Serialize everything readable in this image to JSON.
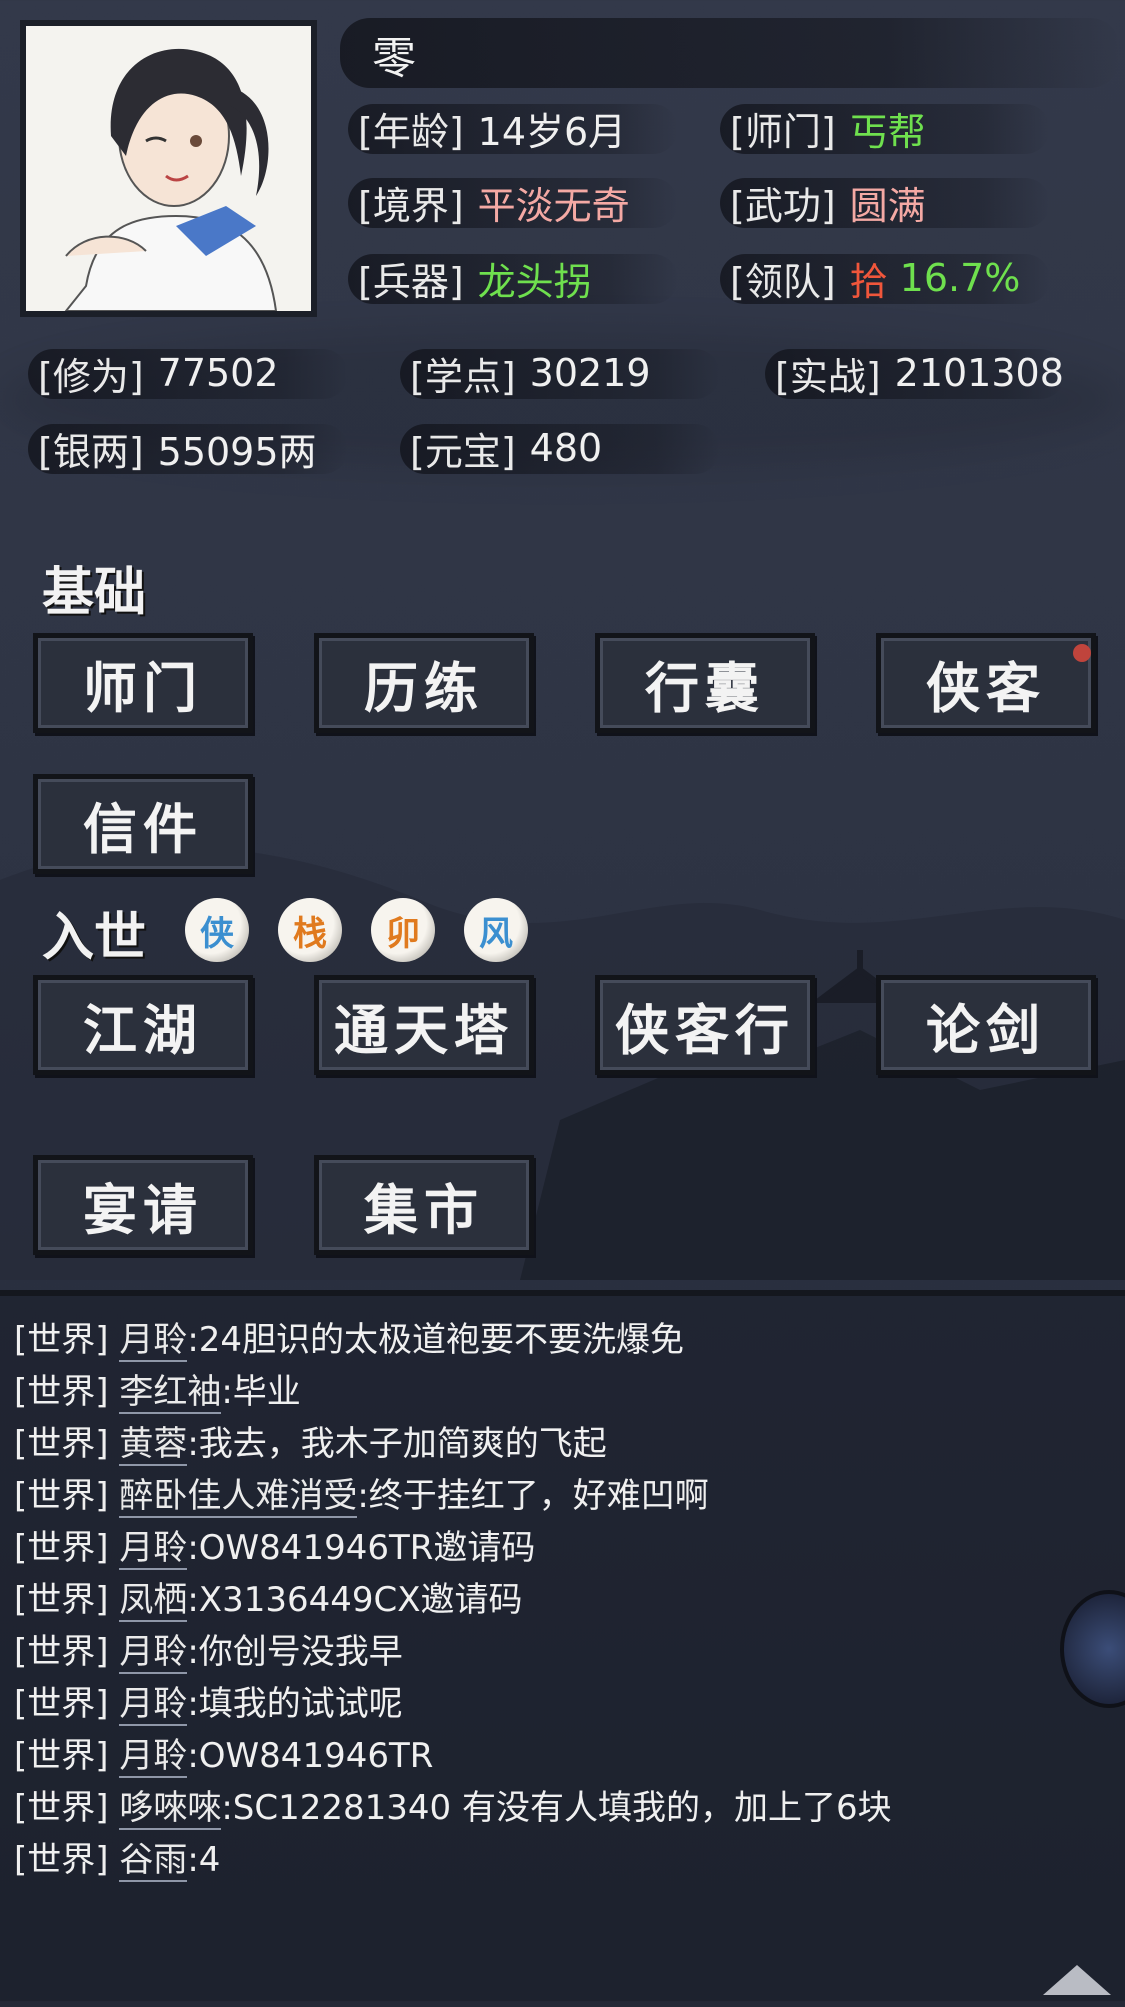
{
  "character": {
    "name": "零",
    "age_label": "[年龄]",
    "age": "14岁6月",
    "sect_label": "[师门]",
    "sect": "丐帮",
    "realm_label": "[境界]",
    "realm": "平淡无奇",
    "martial_label": "[武功]",
    "martial": "圆满",
    "weapon_label": "[兵器]",
    "weapon": "龙头拐",
    "team_label": "[领队]",
    "team_rank": "拾",
    "team_pct": "16.7%"
  },
  "stats": {
    "cultivation_label": "[修为]",
    "cultivation": "77502",
    "study_label": "[学点]",
    "study": "30219",
    "combat_label": "[实战]",
    "combat": "2101308",
    "silver_label": "[银两]",
    "silver": "55095两",
    "ingot_label": "[元宝]",
    "ingot": "480"
  },
  "basics": {
    "title": "基础",
    "buttons": [
      "师门",
      "历练",
      "行囊",
      "侠客",
      "信件"
    ]
  },
  "world": {
    "title": "入世",
    "badges": [
      {
        "char": "侠",
        "color": "#3b8fd0"
      },
      {
        "char": "栈",
        "color": "#e07a1e"
      },
      {
        "char": "卯",
        "color": "#e07a1e"
      },
      {
        "char": "风",
        "color": "#3b8fd0"
      }
    ],
    "buttons": [
      "江湖",
      "通天塔",
      "侠客行",
      "论剑",
      "宴请",
      "集市"
    ]
  },
  "chat": [
    {
      "channel": "[世界]",
      "name": "月聆",
      "msg": ":24胆识的太极道袍要不要洗爆免"
    },
    {
      "channel": "[世界]",
      "name": "李红袖",
      "msg": ":毕业"
    },
    {
      "channel": "[世界]",
      "name": "黄蓉",
      "msg": ":我去，我木子加简爽的飞起"
    },
    {
      "channel": "[世界]",
      "name": "醉卧佳人难消受",
      "msg": ":终于挂红了，好难凹啊"
    },
    {
      "channel": "[世界]",
      "name": "月聆",
      "msg": ":OW841946TR邀请码"
    },
    {
      "channel": "[世界]",
      "name": "凤栖",
      "msg": ":X3136449CX邀请码"
    },
    {
      "channel": "[世界]",
      "name": "月聆",
      "msg": ":你创号没我早"
    },
    {
      "channel": "[世界]",
      "name": "月聆",
      "msg": ":填我的试试呢"
    },
    {
      "channel": "[世界]",
      "name": "月聆",
      "msg": ":OW841946TR"
    },
    {
      "channel": "[世界]",
      "name": "哆唻唻",
      "msg": ":SC12281340  有没有人填我的，加上了6块"
    },
    {
      "channel": "[世界]",
      "name": "谷雨",
      "msg": ":4"
    }
  ],
  "colors": {
    "green": "#6fe04e",
    "pink": "#f4a9a4",
    "red": "#f0563b",
    "notify_dot": "#c0443c"
  }
}
